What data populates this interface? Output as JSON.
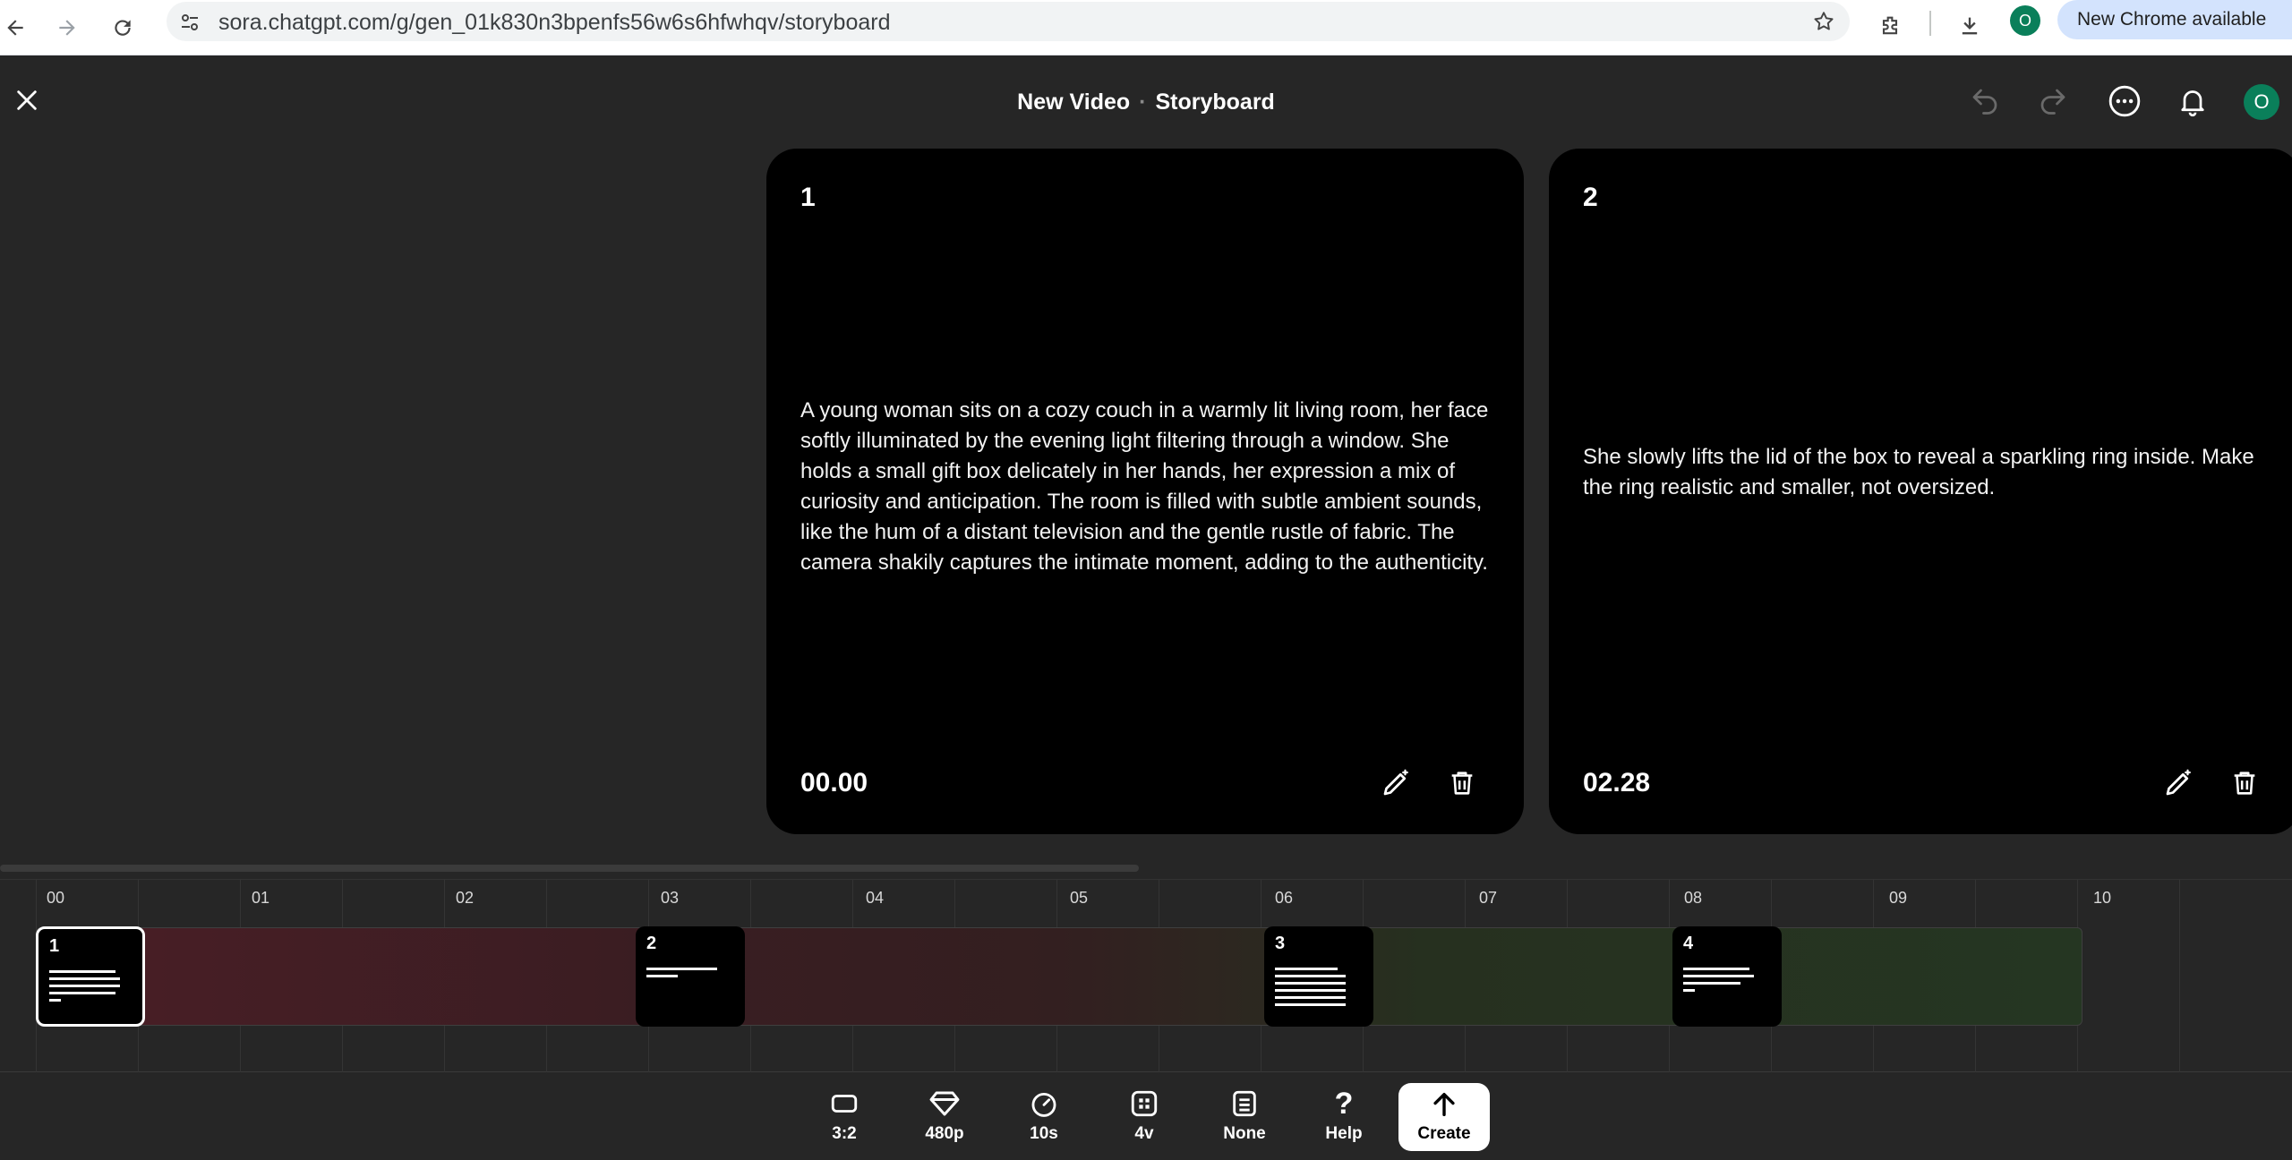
{
  "browser": {
    "url": "sora.chatgpt.com/g/gen_01k830n3bpenfs56w6s6hfwhqv/storyboard",
    "profile_initial": "O",
    "update_label": "New Chrome available"
  },
  "header": {
    "title": "New Video",
    "subtitle": "Storyboard",
    "avatar_initial": "O"
  },
  "cards": [
    {
      "number": "1",
      "prompt": "A young woman sits on a cozy couch in a warmly lit living room, her face softly illuminated by the evening light filtering through a window. She holds a small gift box delicately in her hands, her expression a mix of curiosity and anticipation. The room is filled with subtle ambient sounds, like the hum of a distant television and the gentle rustle of fabric. The camera shakily captures the intimate moment, adding to the authenticity.",
      "time": "00.00"
    },
    {
      "number": "2",
      "prompt": "She slowly lifts the lid of the box to reveal a sparkling ring inside. Make the ring realistic and smaller, not oversized.",
      "time": "02.28"
    }
  ],
  "timeline": {
    "ticks": [
      "00",
      "01",
      "02",
      "03",
      "04",
      "05",
      "06",
      "07",
      "08",
      "09",
      "10"
    ],
    "clips": [
      {
        "number": "1"
      },
      {
        "number": "2"
      },
      {
        "number": "3"
      },
      {
        "number": "4"
      }
    ]
  },
  "toolbar": {
    "aspect": "3:2",
    "resolution": "480p",
    "duration": "10s",
    "variations": "4v",
    "preset": "None",
    "help": "Help",
    "create": "Create"
  },
  "colors": {
    "accent_green": "#0a7f5a",
    "card_bg": "#000000",
    "app_bg": "#262626"
  }
}
